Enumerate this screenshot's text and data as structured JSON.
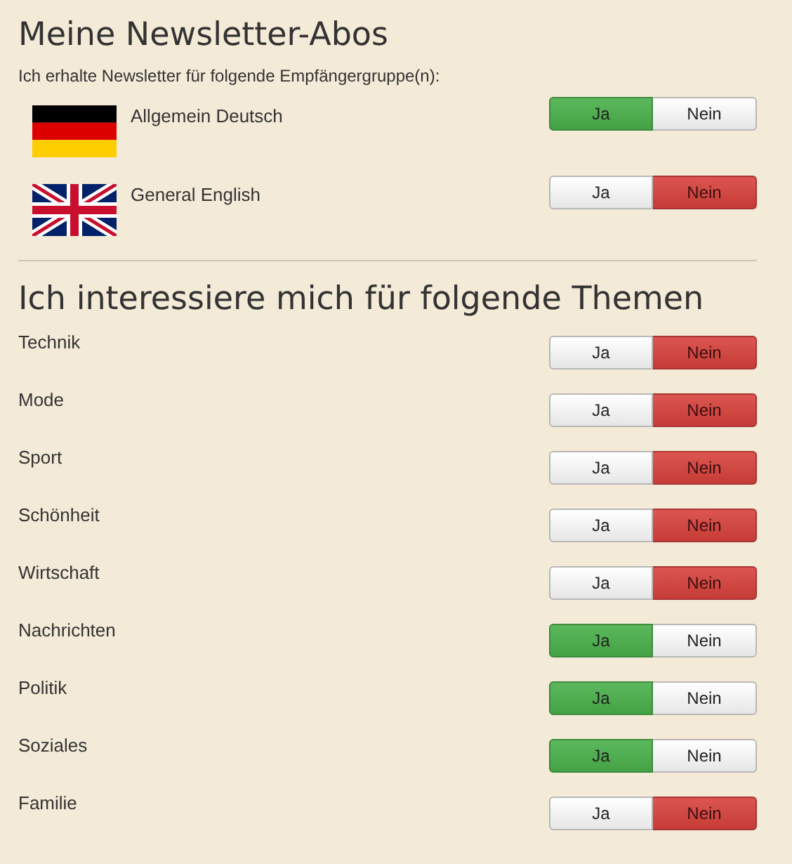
{
  "newsletter": {
    "title": "Meine Newsletter-Abos",
    "intro": "Ich erhalte Newsletter für folgende Empfängergruppe(n):",
    "groups": [
      {
        "kind": "german",
        "label": "Allgemein Deutsch",
        "options": [
          {
            "kind": "yes",
            "label": "Ja",
            "selected": true
          },
          {
            "kind": "no",
            "label": "Nein",
            "selected": false
          }
        ]
      },
      {
        "kind": "british",
        "label": "General English",
        "options": [
          {
            "kind": "yes",
            "label": "Ja",
            "selected": false
          },
          {
            "kind": "no",
            "label": "Nein",
            "selected": true
          }
        ]
      }
    ]
  },
  "topics": {
    "title": "Ich interessiere mich für folgende Themen",
    "items": [
      {
        "label": "Technik",
        "options": [
          {
            "kind": "yes",
            "label": "Ja",
            "selected": false
          },
          {
            "kind": "no",
            "label": "Nein",
            "selected": true
          }
        ]
      },
      {
        "label": "Mode",
        "options": [
          {
            "kind": "yes",
            "label": "Ja",
            "selected": false
          },
          {
            "kind": "no",
            "label": "Nein",
            "selected": true
          }
        ]
      },
      {
        "label": "Sport",
        "options": [
          {
            "kind": "yes",
            "label": "Ja",
            "selected": false
          },
          {
            "kind": "no",
            "label": "Nein",
            "selected": true
          }
        ]
      },
      {
        "label": "Schönheit",
        "options": [
          {
            "kind": "yes",
            "label": "Ja",
            "selected": false
          },
          {
            "kind": "no",
            "label": "Nein",
            "selected": true
          }
        ]
      },
      {
        "label": "Wirtschaft",
        "options": [
          {
            "kind": "yes",
            "label": "Ja",
            "selected": false
          },
          {
            "kind": "no",
            "label": "Nein",
            "selected": true
          }
        ]
      },
      {
        "label": "Nachrichten",
        "options": [
          {
            "kind": "yes",
            "label": "Ja",
            "selected": true
          },
          {
            "kind": "no",
            "label": "Nein",
            "selected": false
          }
        ]
      },
      {
        "label": "Politik",
        "options": [
          {
            "kind": "yes",
            "label": "Ja",
            "selected": true
          },
          {
            "kind": "no",
            "label": "Nein",
            "selected": false
          }
        ]
      },
      {
        "label": "Soziales",
        "options": [
          {
            "kind": "yes",
            "label": "Ja",
            "selected": true
          },
          {
            "kind": "no",
            "label": "Nein",
            "selected": false
          }
        ]
      },
      {
        "label": "Familie",
        "options": [
          {
            "kind": "yes",
            "label": "Ja",
            "selected": false
          },
          {
            "kind": "no",
            "label": "Nein",
            "selected": true
          }
        ]
      }
    ]
  }
}
